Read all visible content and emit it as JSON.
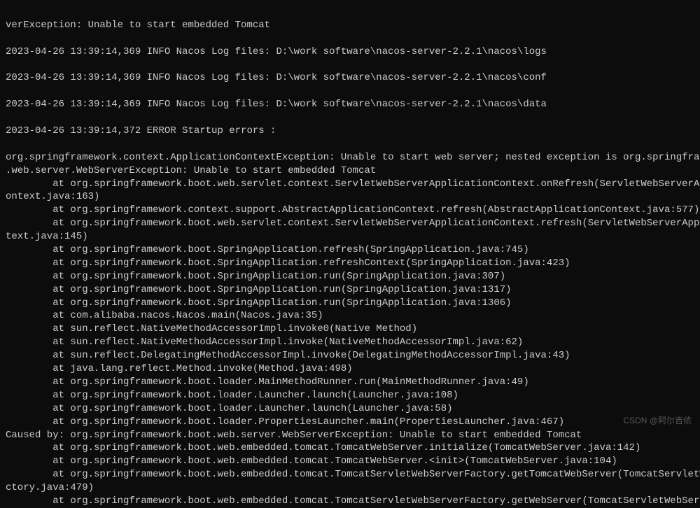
{
  "terminal": {
    "lines": [
      "verException: Unable to start embedded Tomcat",
      "",
      "2023-04-26 13:39:14,369 INFO Nacos Log files: D:\\work software\\nacos-server-2.2.1\\nacos\\logs",
      "",
      "2023-04-26 13:39:14,369 INFO Nacos Log files: D:\\work software\\nacos-server-2.2.1\\nacos\\conf",
      "",
      "2023-04-26 13:39:14,369 INFO Nacos Log files: D:\\work software\\nacos-server-2.2.1\\nacos\\data",
      "",
      "2023-04-26 13:39:14,372 ERROR Startup errors :",
      "",
      "org.springframework.context.ApplicationContextException: Unable to start web server; nested exception is org.springframew",
      ".web.server.WebServerException: Unable to start embedded Tomcat",
      "        at org.springframework.boot.web.servlet.context.ServletWebServerApplicationContext.onRefresh(ServletWebServerAppl",
      "ontext.java:163)",
      "        at org.springframework.context.support.AbstractApplicationContext.refresh(AbstractApplicationContext.java:577)",
      "        at org.springframework.boot.web.servlet.context.ServletWebServerApplicationContext.refresh(ServletWebServerApplic",
      "text.java:145)",
      "        at org.springframework.boot.SpringApplication.refresh(SpringApplication.java:745)",
      "        at org.springframework.boot.SpringApplication.refreshContext(SpringApplication.java:423)",
      "        at org.springframework.boot.SpringApplication.run(SpringApplication.java:307)",
      "        at org.springframework.boot.SpringApplication.run(SpringApplication.java:1317)",
      "        at org.springframework.boot.SpringApplication.run(SpringApplication.java:1306)",
      "        at com.alibaba.nacos.Nacos.main(Nacos.java:35)",
      "        at sun.reflect.NativeMethodAccessorImpl.invoke0(Native Method)",
      "        at sun.reflect.NativeMethodAccessorImpl.invoke(NativeMethodAccessorImpl.java:62)",
      "        at sun.reflect.DelegatingMethodAccessorImpl.invoke(DelegatingMethodAccessorImpl.java:43)",
      "        at java.lang.reflect.Method.invoke(Method.java:498)",
      "        at org.springframework.boot.loader.MainMethodRunner.run(MainMethodRunner.java:49)",
      "        at org.springframework.boot.loader.Launcher.launch(Launcher.java:108)",
      "        at org.springframework.boot.loader.Launcher.launch(Launcher.java:58)",
      "        at org.springframework.boot.loader.PropertiesLauncher.main(PropertiesLauncher.java:467)",
      "Caused by: org.springframework.boot.web.server.WebServerException: Unable to start embedded Tomcat",
      "        at org.springframework.boot.web.embedded.tomcat.TomcatWebServer.initialize(TomcatWebServer.java:142)",
      "        at org.springframework.boot.web.embedded.tomcat.TomcatWebServer.<init>(TomcatWebServer.java:104)",
      "        at org.springframework.boot.web.embedded.tomcat.TomcatServletWebServerFactory.getTomcatWebServer(TomcatServletWeb",
      "ctory.java:479)",
      "        at org.springframework.boot.web.embedded.tomcat.TomcatServletWebServerFactory.getWebServer(TomcatServletWebServer"
    ]
  },
  "watermark": "CSDN @阿尔吉侬"
}
